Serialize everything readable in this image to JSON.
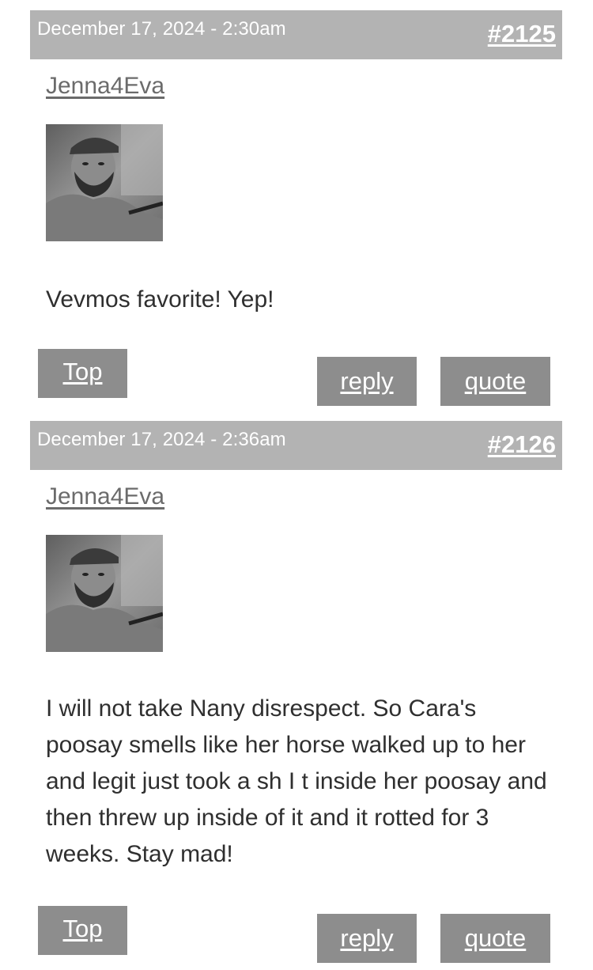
{
  "posts": [
    {
      "date": "December 17, 2024 - 2:30am",
      "number": "#2125",
      "author": "Jenna4Eva",
      "avatar_icon": "user-photo-avatar",
      "body": "Vevmos favorite! Yep!",
      "buttons": {
        "top": "Top",
        "reply": "reply",
        "quote": "quote"
      }
    },
    {
      "date": "December 17, 2024 - 2:36am",
      "number": "#2126",
      "author": "Jenna4Eva",
      "avatar_icon": "user-photo-avatar",
      "body": "I will not take Nany disrespect. So Cara's poosay smells like her horse walked up to her and legit just took a sh I t inside her poosay and then threw up inside of it and it rotted for 3 weeks. Stay mad!",
      "buttons": {
        "top": "Top",
        "reply": "reply",
        "quote": "quote"
      }
    }
  ],
  "colors": {
    "header_bg": "#b3b3b3",
    "button_bg": "#8d8d8d",
    "author_link": "#6b6b6b"
  }
}
